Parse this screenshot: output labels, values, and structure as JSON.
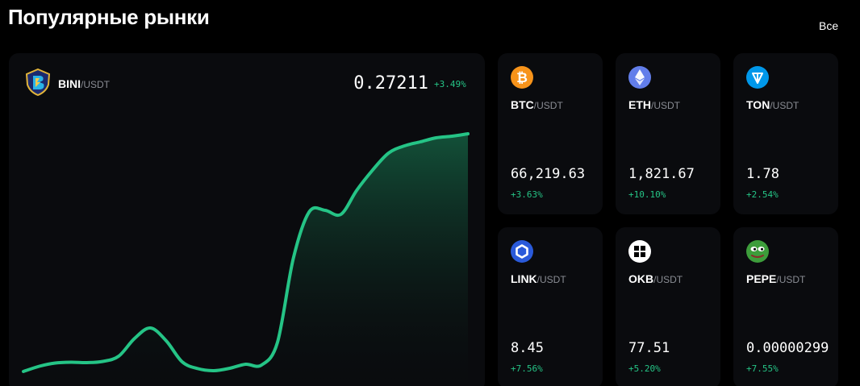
{
  "header": {
    "title": "Популярные рынки",
    "all_label": "Все"
  },
  "featured": {
    "symbol": "BINI",
    "quote": "/USDT",
    "price": "0.27211",
    "change": "+3.49%",
    "icon": "bini-logo-icon",
    "accent": "#25c486"
  },
  "chart_data": {
    "type": "area",
    "x": [
      0,
      1,
      2,
      3,
      4,
      5,
      6,
      7,
      8,
      9,
      10,
      11,
      12,
      13,
      14,
      15,
      16,
      17,
      18,
      19,
      20,
      21,
      22,
      23,
      24,
      25,
      26,
      27,
      28
    ],
    "values": [
      0.05,
      0.115,
      0.155,
      0.165,
      0.16,
      0.175,
      0.24,
      0.46,
      0.59,
      0.43,
      0.17,
      0.085,
      0.06,
      0.09,
      0.14,
      0.13,
      0.41,
      1.45,
      2.03,
      2.05,
      2.0,
      2.3,
      2.55,
      2.76,
      2.85,
      2.9,
      2.95,
      2.97,
      3.0
    ],
    "ylim": [
      0,
      3.4
    ]
  },
  "markets": [
    {
      "symbol": "BTC",
      "quote": "/USDT",
      "price": "66,219.63",
      "change": "+3.63%",
      "icon": "bitcoin-icon",
      "color": "#f7931a"
    },
    {
      "symbol": "ETH",
      "quote": "/USDT",
      "price": "1,821.67",
      "change": "+10.10%",
      "icon": "ethereum-icon",
      "color": "#627eea"
    },
    {
      "symbol": "TON",
      "quote": "/USDT",
      "price": "1.78",
      "change": "+2.54%",
      "icon": "ton-icon",
      "color": "#0098ea"
    },
    {
      "symbol": "LINK",
      "quote": "/USDT",
      "price": "8.45",
      "change": "+7.56%",
      "icon": "chainlink-icon",
      "color": "#2a5ada"
    },
    {
      "symbol": "OKB",
      "quote": "/USDT",
      "price": "77.51",
      "change": "+5.20%",
      "icon": "okb-icon",
      "color": "#ffffff"
    },
    {
      "symbol": "PEPE",
      "quote": "/USDT",
      "price": "0.00000299",
      "change": "+7.55%",
      "icon": "pepe-icon",
      "color": "#3d9d3b"
    }
  ]
}
